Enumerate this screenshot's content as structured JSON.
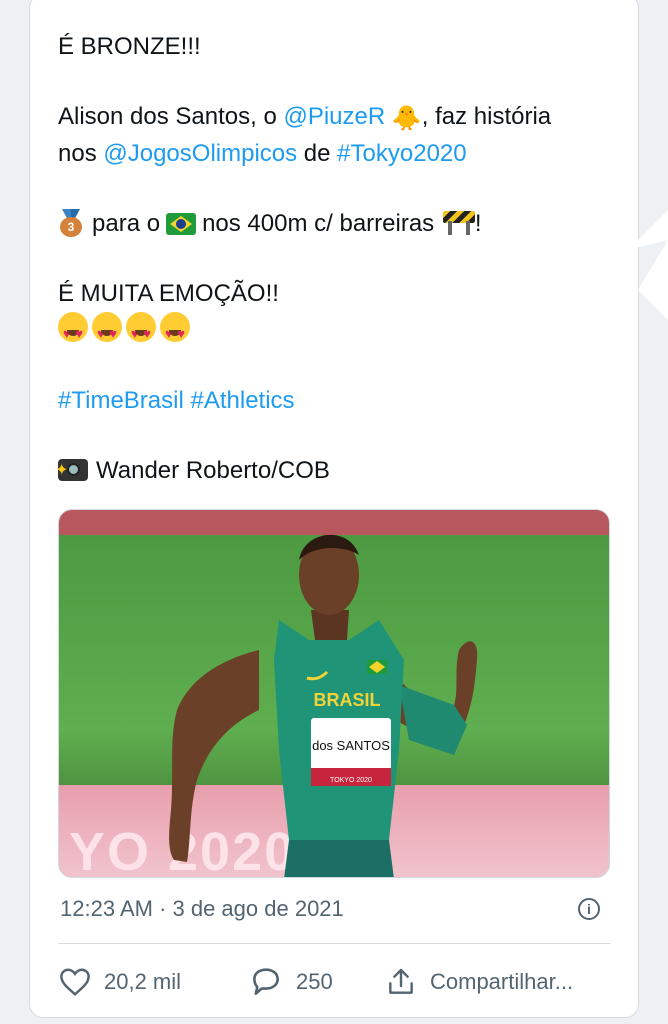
{
  "tweet": {
    "headline": "É BRONZE!!!",
    "line1_a": "Alison dos Santos, o ",
    "mention1": "@PiuzeR",
    "line1_b": ", faz história",
    "line2_a": "nos ",
    "mention2": "@JogosOlimpicos",
    "line2_b": " de ",
    "hashtag1": "#Tokyo2020",
    "line3_a": "para o",
    "line3_b": "nos 400m c/ barreiras",
    "line3_c": "!",
    "line4": "É MUITA EMOÇÃO!!",
    "hashtag2": "#TimeBrasil",
    "hashtag3": "#Athletics",
    "credit": "Wander Roberto/COB",
    "medal_number": "3"
  },
  "photo": {
    "jersey_text": "BRASIL",
    "bib_name": "dos SANTOS",
    "bib_sub": "TOKYO 2020",
    "track_text": "YO 2020"
  },
  "meta": {
    "timestamp": "12:23 AM · 3 de ago de 2021",
    "info_glyph": "i"
  },
  "actions": {
    "likes": "20,2 mil",
    "replies": "250",
    "share": "Compartilhar..."
  },
  "colors": {
    "link": "#1d9bf0",
    "muted": "#536471"
  }
}
